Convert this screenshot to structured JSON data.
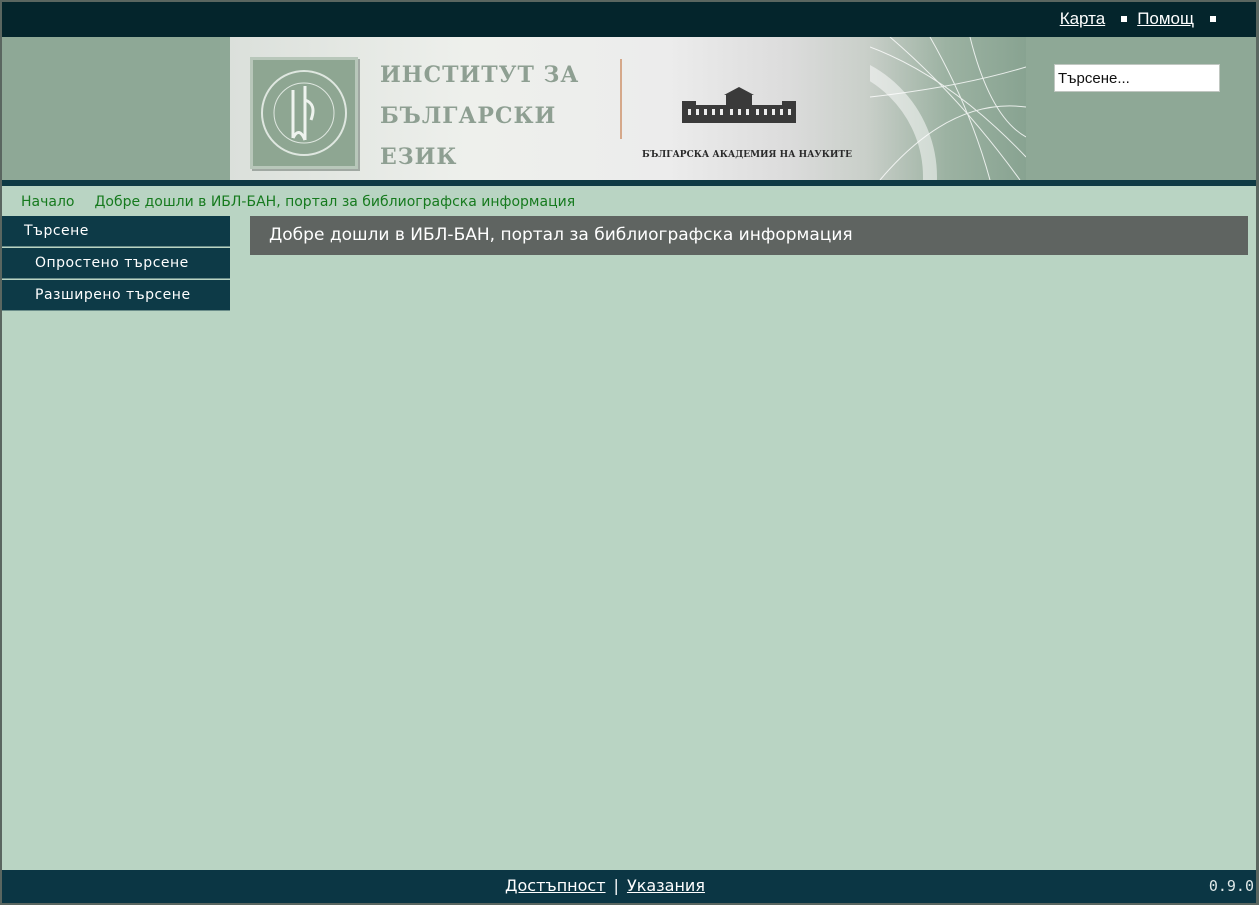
{
  "topbar": {
    "links": [
      {
        "label": "Карта"
      },
      {
        "label": "Помощ"
      }
    ]
  },
  "header": {
    "banner": {
      "title_lines": [
        "ИНСТИТУТ ЗА",
        "БЪЛГАРСКИ",
        "ЕЗИК"
      ],
      "academy": "БЪЛГАРСКА АКАДЕМИЯ НА НАУКИТЕ"
    },
    "search": {
      "value": "Търсене..."
    }
  },
  "breadcrumb": {
    "home": "Начало",
    "current": "Добре дошли в ИБЛ-БАН, портал за библиографска информация"
  },
  "sidebar": {
    "items": [
      {
        "label": "Търсене",
        "type": "head"
      },
      {
        "label": "Опростено търсене",
        "type": "sub"
      },
      {
        "label": "Разширено търсене",
        "type": "sub"
      }
    ]
  },
  "main": {
    "title": "Добре дошли в ИБЛ-БАН, портал за библиографска информация"
  },
  "footer": {
    "links": [
      {
        "label": "Достъпност"
      },
      {
        "label": "Указания"
      }
    ],
    "separator": "|",
    "version": "0.9.0"
  },
  "colors": {
    "topbar": "#04252c",
    "header": "#8ea896",
    "page": "#b9d4c3",
    "sidebar": "#0d3a47",
    "content_title": "#5f6461",
    "breadcrumb_text": "#167a1e",
    "footer": "#0b3644"
  }
}
